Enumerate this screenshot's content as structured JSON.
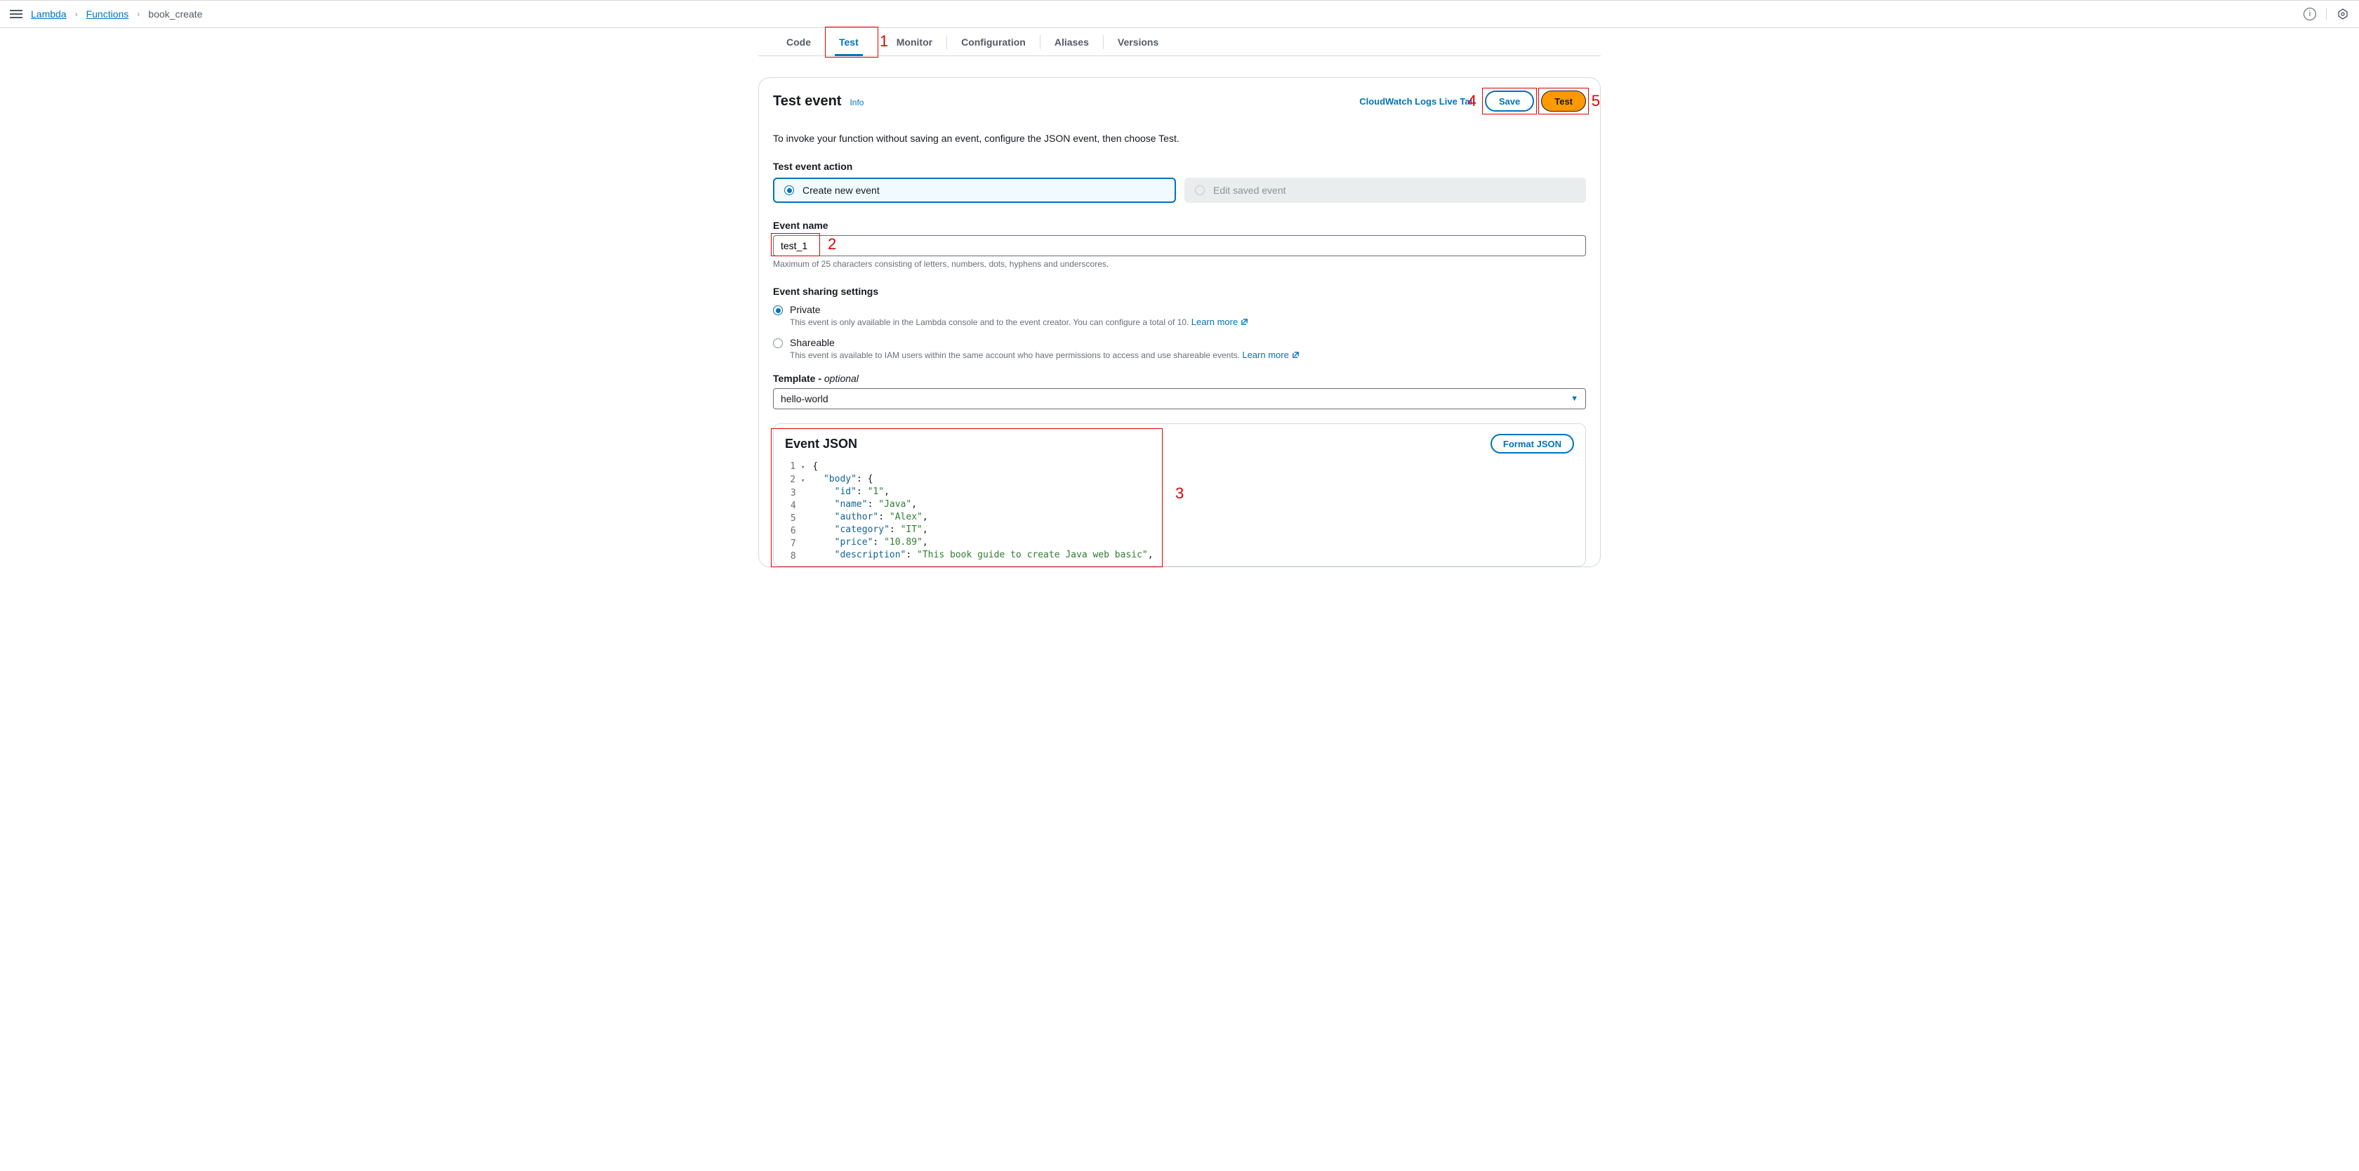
{
  "breadcrumbs": {
    "root": "Lambda",
    "mid": "Functions",
    "current": "book_create"
  },
  "tabs": {
    "code": "Code",
    "test": "Test",
    "monitor": "Monitor",
    "configuration": "Configuration",
    "aliases": "Aliases",
    "versions": "Versions"
  },
  "panel": {
    "title": "Test event",
    "info": "Info",
    "actions": {
      "cwlt": "CloudWatch Logs Live Tail",
      "save": "Save",
      "test": "Test"
    },
    "description": "To invoke your function without saving an event, configure the JSON event, then choose Test."
  },
  "action_section": {
    "label": "Test event action",
    "create": "Create new event",
    "edit": "Edit saved event"
  },
  "event_name": {
    "label": "Event name",
    "value": "test_1",
    "hint": "Maximum of 25 characters consisting of letters, numbers, dots, hyphens and underscores."
  },
  "sharing": {
    "label": "Event sharing settings",
    "private": {
      "label": "Private",
      "desc": "This event is only available in the Lambda console and to the event creator. You can configure a total of 10.",
      "learn": "Learn more"
    },
    "shareable": {
      "label": "Shareable",
      "desc": "This event is available to IAM users within the same account who have permissions to access and use shareable events.",
      "learn": "Learn more"
    }
  },
  "template": {
    "label_prefix": "Template - ",
    "label_suffix": "optional",
    "value": "hello-world"
  },
  "json_editor": {
    "title": "Event JSON",
    "format": "Format JSON",
    "lines": [
      {
        "n": "1",
        "fold": true,
        "indent": 0,
        "tokens": [
          {
            "t": "punc",
            "v": "{"
          }
        ]
      },
      {
        "n": "2",
        "fold": true,
        "indent": 1,
        "tokens": [
          {
            "t": "key",
            "v": "\"body\""
          },
          {
            "t": "punc",
            "v": ": {"
          }
        ]
      },
      {
        "n": "3",
        "fold": false,
        "indent": 2,
        "tokens": [
          {
            "t": "key",
            "v": "\"id\""
          },
          {
            "t": "punc",
            "v": ": "
          },
          {
            "t": "str",
            "v": "\"1\""
          },
          {
            "t": "punc",
            "v": ","
          }
        ]
      },
      {
        "n": "4",
        "fold": false,
        "indent": 2,
        "tokens": [
          {
            "t": "key",
            "v": "\"name\""
          },
          {
            "t": "punc",
            "v": ": "
          },
          {
            "t": "str",
            "v": "\"Java\""
          },
          {
            "t": "punc",
            "v": ","
          }
        ]
      },
      {
        "n": "5",
        "fold": false,
        "indent": 2,
        "tokens": [
          {
            "t": "key",
            "v": "\"author\""
          },
          {
            "t": "punc",
            "v": ": "
          },
          {
            "t": "str",
            "v": "\"Alex\""
          },
          {
            "t": "punc",
            "v": ","
          }
        ]
      },
      {
        "n": "6",
        "fold": false,
        "indent": 2,
        "tokens": [
          {
            "t": "key",
            "v": "\"category\""
          },
          {
            "t": "punc",
            "v": ": "
          },
          {
            "t": "str",
            "v": "\"IT\""
          },
          {
            "t": "punc",
            "v": ","
          }
        ]
      },
      {
        "n": "7",
        "fold": false,
        "indent": 2,
        "tokens": [
          {
            "t": "key",
            "v": "\"price\""
          },
          {
            "t": "punc",
            "v": ": "
          },
          {
            "t": "str",
            "v": "\"10.89\""
          },
          {
            "t": "punc",
            "v": ","
          }
        ]
      },
      {
        "n": "8",
        "fold": false,
        "indent": 2,
        "tokens": [
          {
            "t": "key",
            "v": "\"description\""
          },
          {
            "t": "punc",
            "v": ": "
          },
          {
            "t": "str",
            "v": "\"This book guide to create Java web basic\""
          },
          {
            "t": "punc",
            "v": ","
          }
        ]
      }
    ]
  },
  "annotations": {
    "n1": "1",
    "n2": "2",
    "n3": "3",
    "n4": "4",
    "n5": "5"
  }
}
